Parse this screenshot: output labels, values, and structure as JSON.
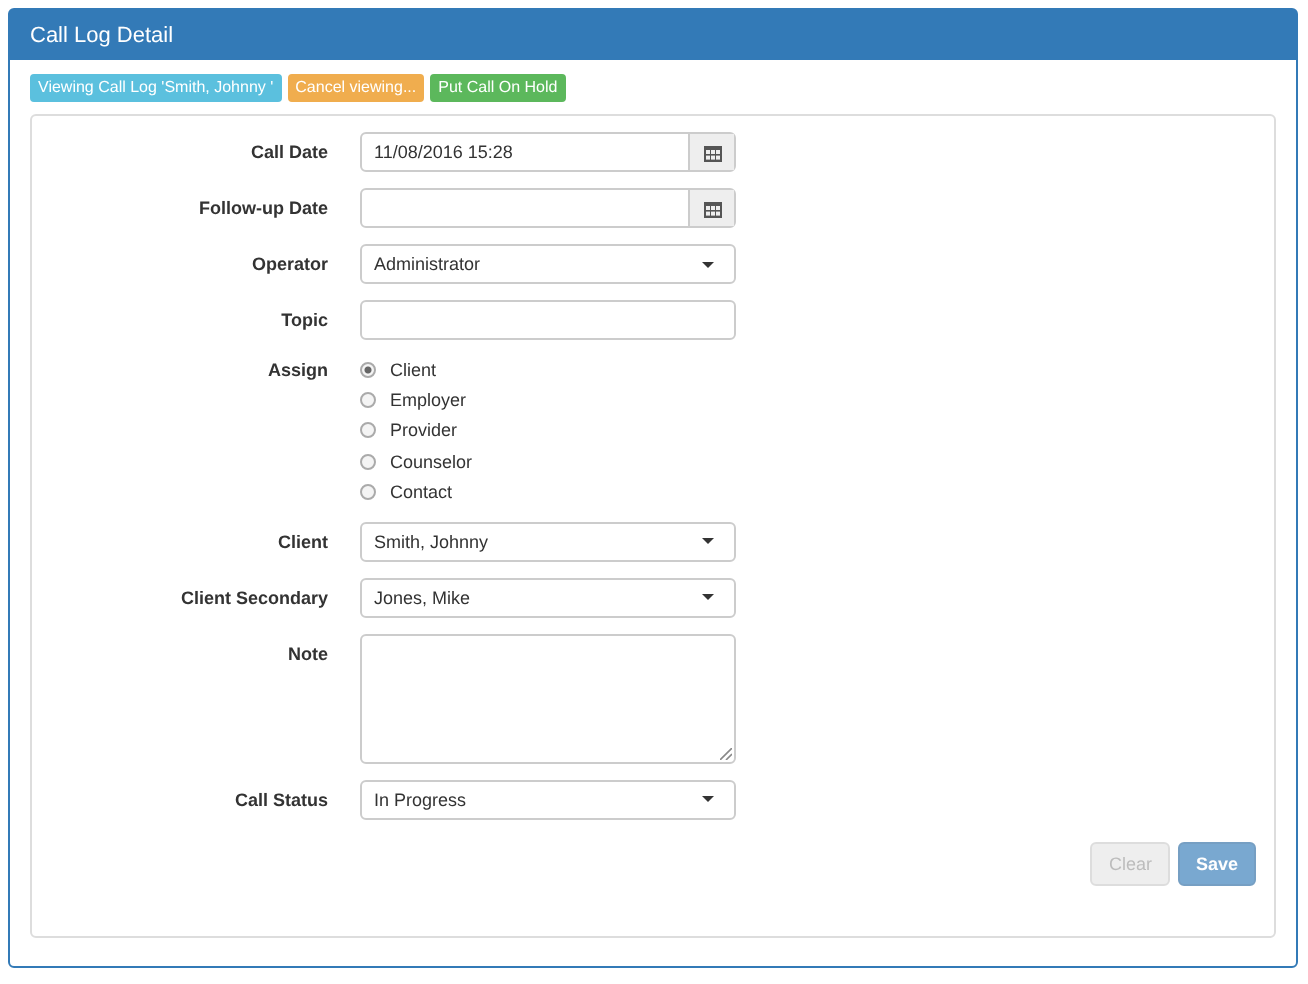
{
  "panel": {
    "title": "Call Log Detail"
  },
  "badges": [
    {
      "label": "Viewing Call Log 'Smith, Johnny '",
      "color": "#5bc0de"
    },
    {
      "label": "Cancel viewing...",
      "color": "#f0ad4e"
    },
    {
      "label": "Put Call On Hold",
      "color": "#5cb85c"
    }
  ],
  "fields": [
    {
      "kind": "date",
      "label": "Call Date",
      "value": "11/08/2016 15:28"
    },
    {
      "kind": "date",
      "label": "Follow-up Date"
    },
    {
      "kind": "select",
      "label": "Operator",
      "value": "Administrator"
    },
    {
      "kind": "text",
      "label": "Topic"
    },
    {
      "kind": "radio",
      "label": "Assign",
      "options": [
        {
          "label": "Client",
          "selected": true
        },
        {
          "label": "Employer",
          "selected": false
        },
        {
          "label": "Provider",
          "selected": false
        },
        {
          "label": "Counselor",
          "selected": false
        },
        {
          "label": "Contact",
          "selected": false
        }
      ]
    },
    {
      "kind": "select",
      "label": "Client",
      "value": "Smith, Johnny"
    },
    {
      "kind": "select",
      "label": "Client Secondary",
      "value": "Jones, Mike"
    },
    {
      "kind": "textarea",
      "label": "Note"
    },
    {
      "kind": "select",
      "label": "Call Status",
      "value": "In Progress"
    }
  ],
  "buttons": [
    {
      "kind": "default",
      "label": "Clear",
      "disabled": true
    },
    {
      "kind": "primary",
      "label": "Save",
      "disabled": true
    }
  ]
}
